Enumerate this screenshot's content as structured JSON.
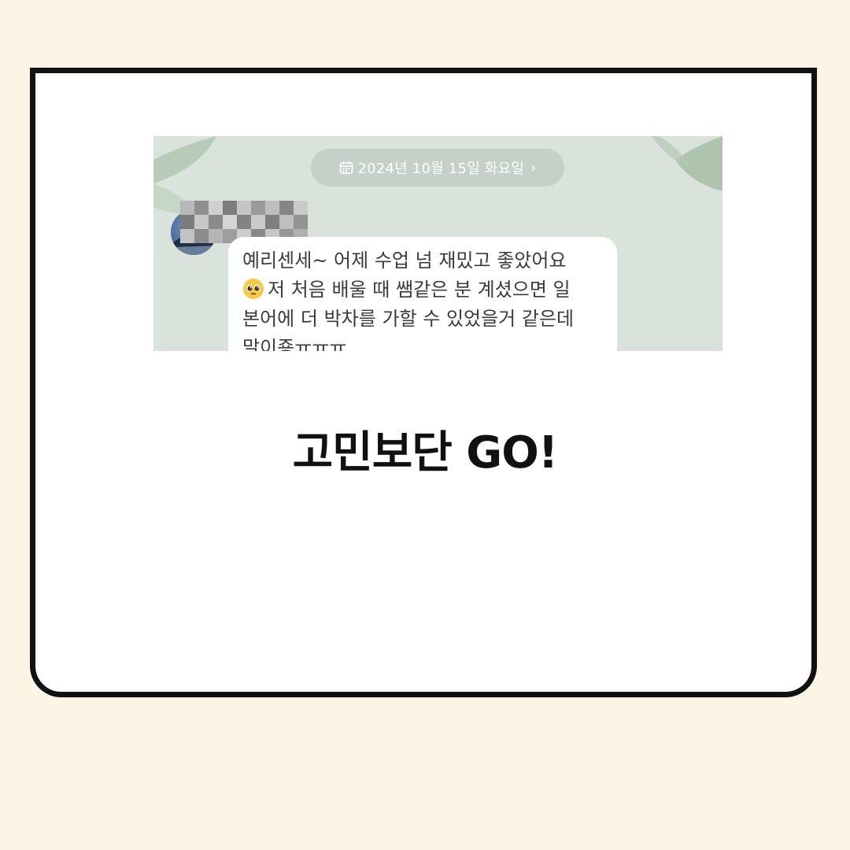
{
  "chat": {
    "date_label": "2024년 10월 15일 화요일",
    "message_lines": [
      "예리센세~ 어제 수업 넘 재밌고 좋았어요",
      "저 처음 배울 때 쌤같은 분 계셨으면 일",
      "본어에 더 박차를 가할 수 있었을거 같은데",
      "말이죵ㅠㅠㅠ"
    ],
    "emoji": "pleading-face",
    "sender_name_obscured": true
  },
  "headline": "고민보단 GO!",
  "colors": {
    "background": "#fcf5e6",
    "card_border": "#111111",
    "chat_background": "#d9e3dc",
    "date_pill": "#c5d0c8"
  }
}
